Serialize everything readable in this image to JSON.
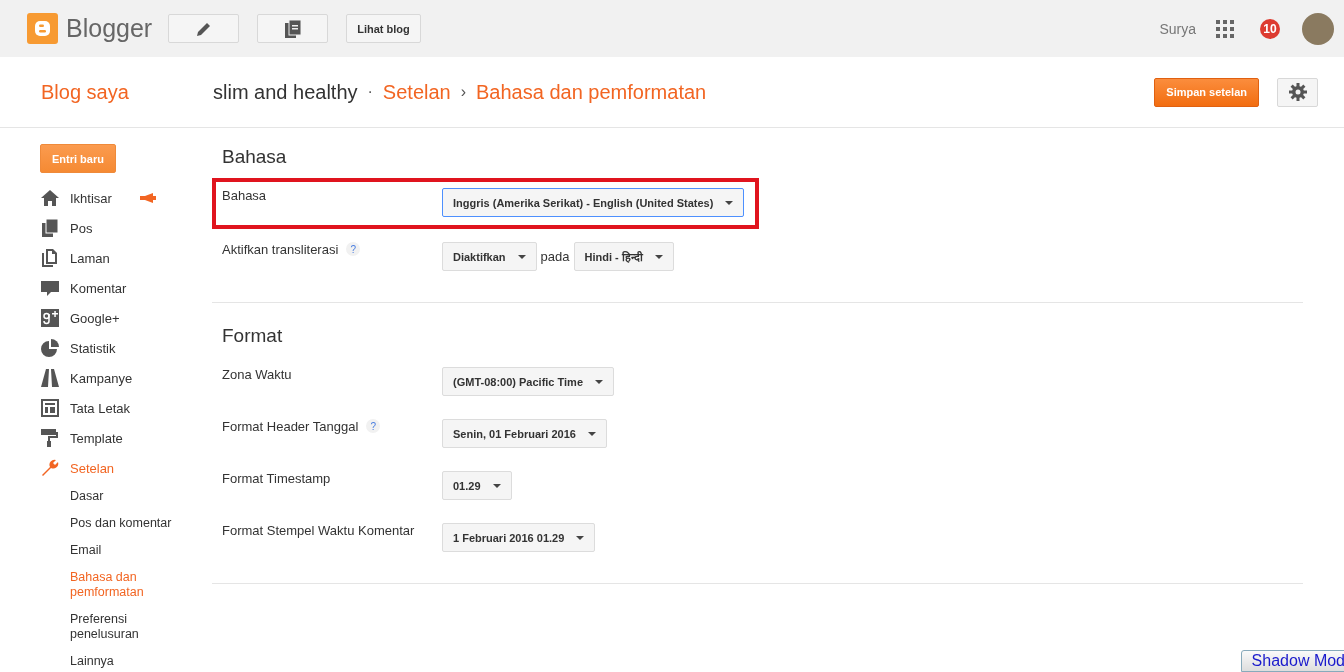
{
  "topbar": {
    "logo": "Blogger",
    "view_blog": "Lihat blog",
    "user": "Surya",
    "notifications": "10"
  },
  "header": {
    "my_blog": "Blog saya",
    "crumbs": [
      {
        "label": "slim and healthy",
        "selected": false
      },
      {
        "label": "Setelan",
        "selected": true
      },
      {
        "label": "Bahasa dan pemformatan",
        "selected": true
      }
    ],
    "separators": [
      "·",
      "›"
    ],
    "save": "Simpan setelan"
  },
  "sidebar": {
    "new_post": "Entri baru",
    "items": [
      {
        "label": "Ikhtisar",
        "selected": false,
        "badge": true
      },
      {
        "label": "Pos",
        "selected": false,
        "badge": false
      },
      {
        "label": "Laman",
        "selected": false,
        "badge": false
      },
      {
        "label": "Komentar",
        "selected": false,
        "badge": false
      },
      {
        "label": "Google+",
        "selected": false,
        "badge": false
      },
      {
        "label": "Statistik",
        "selected": false,
        "badge": false
      },
      {
        "label": "Kampanye",
        "selected": false,
        "badge": false
      },
      {
        "label": "Tata Letak",
        "selected": false,
        "badge": false
      },
      {
        "label": "Template",
        "selected": false,
        "badge": false
      },
      {
        "label": "Setelan",
        "selected": true,
        "badge": false,
        "children": [
          {
            "label": "Dasar",
            "selected": false
          },
          {
            "label": "Pos dan komentar",
            "selected": false
          },
          {
            "label": "Email",
            "selected": false
          },
          {
            "label": "Bahasa dan pemformatan",
            "selected": true
          },
          {
            "label": "Preferensi penelusuran",
            "selected": false
          },
          {
            "label": "Lainnya",
            "selected": false
          }
        ]
      }
    ]
  },
  "sections": [
    {
      "title": "Bahasa",
      "rows": [
        {
          "label": "Bahasa",
          "highlighted": true,
          "focused": true,
          "controls": [
            "Inggris (Amerika Serikat) - English (United States)"
          ]
        },
        {
          "label": "Aktifkan transliterasi",
          "help": "?",
          "highlighted": false,
          "focused": false,
          "controls": [
            "Diaktifkan",
            "Hindi - हिन्दी"
          ],
          "joiner": "pada"
        }
      ]
    },
    {
      "title": "Format",
      "rows": [
        {
          "label": "Zona Waktu",
          "highlighted": false,
          "focused": false,
          "controls": [
            "(GMT-08:00) Pacific Time"
          ]
        },
        {
          "label": "Format Header Tanggal",
          "help": "?",
          "highlighted": false,
          "focused": false,
          "controls": [
            "Senin, 01 Februari 2016"
          ]
        },
        {
          "label": "Format Timestamp",
          "highlighted": false,
          "focused": false,
          "controls": [
            "01.29"
          ]
        },
        {
          "label": "Format Stempel Waktu Komentar",
          "highlighted": false,
          "focused": false,
          "controls": [
            "1 Februari 2016 01.29"
          ]
        }
      ]
    }
  ],
  "overlay_button": "Shadow Mod"
}
